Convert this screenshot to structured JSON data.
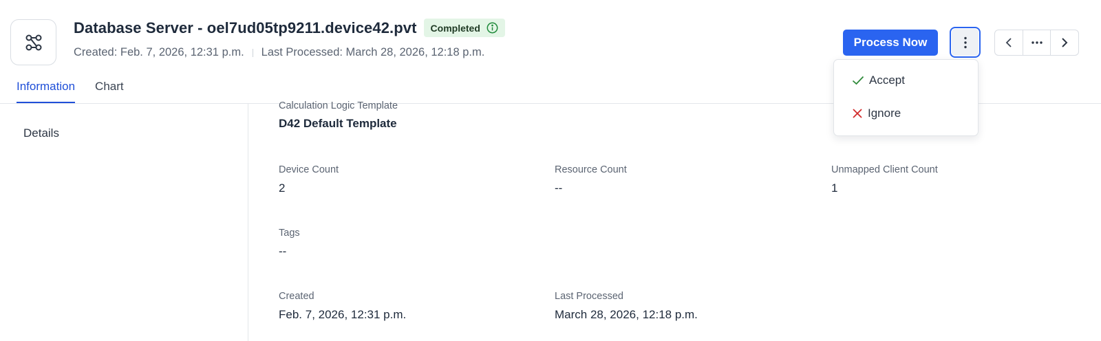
{
  "header": {
    "app_icon": "workflow-nodes-icon",
    "title": "Database Server - oel7ud05tp9211.device42.pvt",
    "status": {
      "label": "Completed",
      "icon": "info-circle-icon",
      "color": "#1f8a3a",
      "background": "#e3f5e6"
    },
    "created": "Created: Feb. 7, 2026, 12:31 p.m.",
    "last_processed": "Last Processed: March 28, 2026, 12:18 p.m."
  },
  "actions": {
    "process_label": "Process Now",
    "more_icon": "vertical-dots-icon",
    "prev_icon": "chevron-left-icon",
    "overflow_icon": "horizontal-dots-icon",
    "next_icon": "chevron-right-icon",
    "accent": "#2a64f0"
  },
  "menu": {
    "items": [
      {
        "label": "Accept",
        "icon": "check-icon",
        "color": "#2f8a3a"
      },
      {
        "label": "Ignore",
        "icon": "close-icon",
        "color": "#d12b2b"
      }
    ]
  },
  "tabs": [
    {
      "label": "Information",
      "active": true
    },
    {
      "label": "Chart",
      "active": false
    }
  ],
  "sidebar": {
    "items": [
      {
        "label": "Details"
      }
    ]
  },
  "details": {
    "template": {
      "label": "Calculation Logic Template",
      "value": "D42 Default Template"
    },
    "device_count": {
      "label": "Device Count",
      "value": "2"
    },
    "resource_count": {
      "label": "Resource Count",
      "value": "--"
    },
    "unmapped_client_count": {
      "label": "Unmapped Client Count",
      "value": "1"
    },
    "tags": {
      "label": "Tags",
      "value": "--"
    },
    "created": {
      "label": "Created",
      "value": "Feb. 7, 2026, 12:31 p.m."
    },
    "last_processed": {
      "label": "Last Processed",
      "value": "March 28, 2026, 12:18 p.m."
    }
  }
}
